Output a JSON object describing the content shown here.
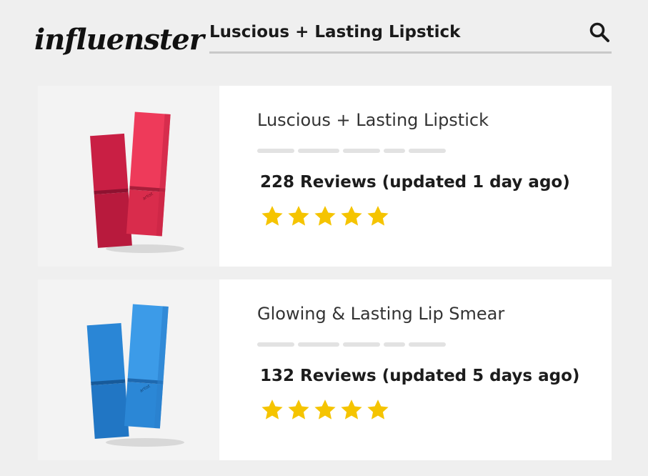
{
  "brand": {
    "logo_text": "influenster"
  },
  "search": {
    "query": "Luscious + Lasting Lipstick",
    "icon": "search-icon"
  },
  "products": [
    {
      "title": "Luscious + Lasting Lipstick",
      "reviews_text": "228 Reviews (updated 1 day ago)",
      "rating": 5,
      "color": "#e8334f",
      "color_dark": "#c41e3c"
    },
    {
      "title": "Glowing & Lasting Lip Smear",
      "reviews_text": "132 Reviews (updated 5 days ago)",
      "rating": 5,
      "color": "#2f8fe0",
      "color_dark": "#1f6fbd"
    }
  ],
  "colors": {
    "star": "#f5c400",
    "background": "#efefef",
    "placeholder_dash": "#e2e2e2"
  }
}
